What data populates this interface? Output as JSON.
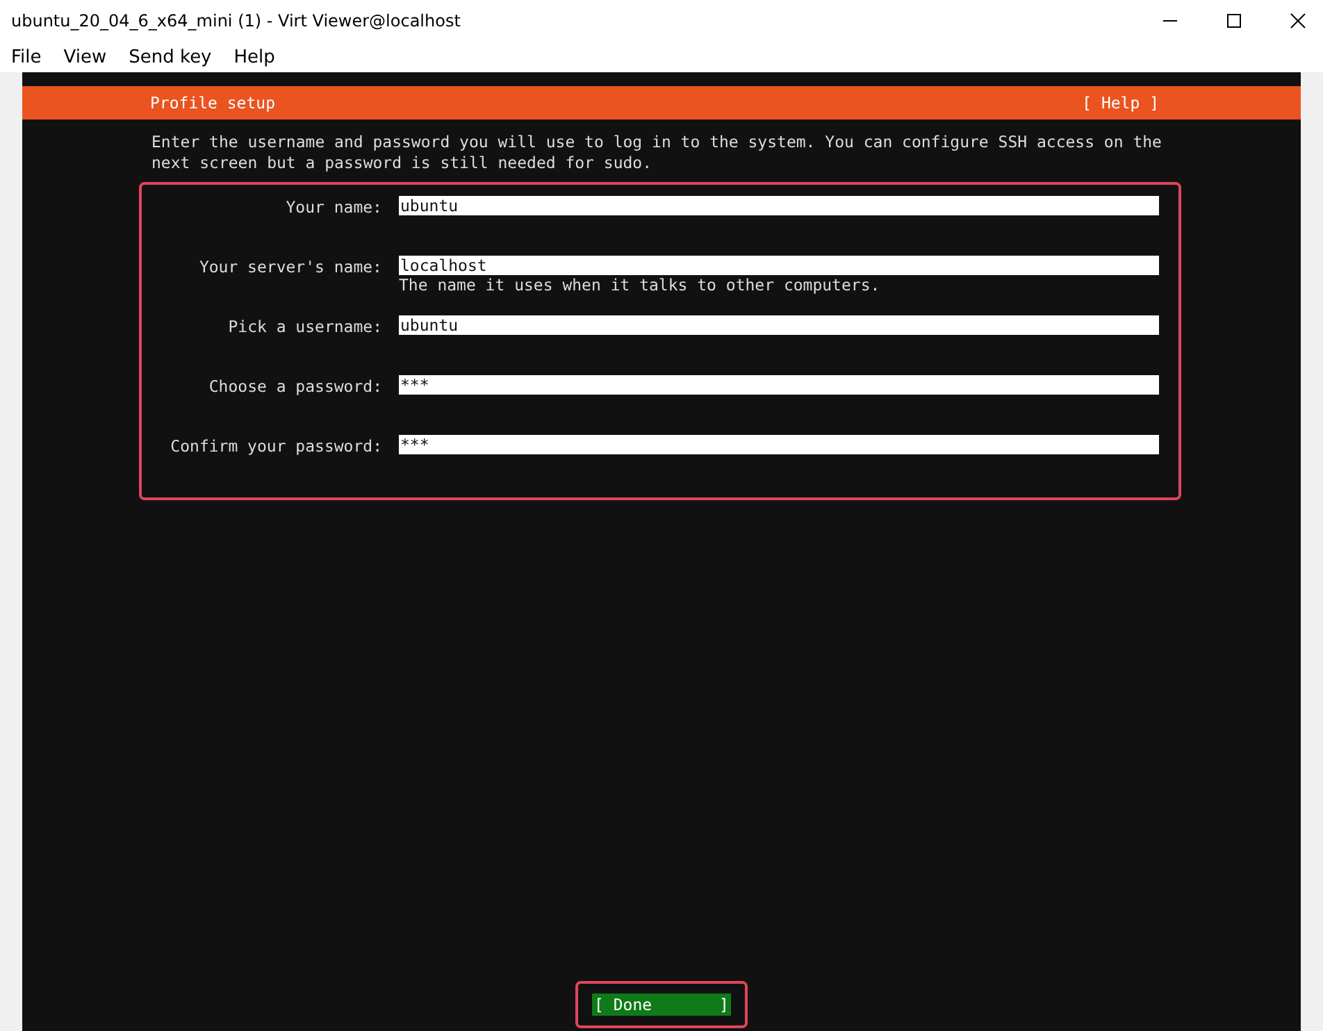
{
  "window": {
    "title": "ubuntu_20_04_6_x64_mini (1) - Virt Viewer@localhost"
  },
  "menu": [
    "File",
    "View",
    "Send key",
    "Help"
  ],
  "header": {
    "title": "Profile setup",
    "help": "[ Help ]"
  },
  "intro": "Enter the username and password you will use to log in to the system. You can configure SSH access on the next screen but a password is still needed for sudo.",
  "fields": [
    {
      "label": "Your name:",
      "value": "ubuntu"
    },
    {
      "label": "Your server's name:",
      "value": "localhost",
      "hint": "The name it uses when it talks to other computers."
    },
    {
      "label": "Pick a username:",
      "value": "ubuntu"
    },
    {
      "label": "Choose a password:",
      "value": "***"
    },
    {
      "label": "Confirm your password:",
      "value": "***"
    }
  ],
  "done_button": {
    "label": "[ Done       ]"
  }
}
